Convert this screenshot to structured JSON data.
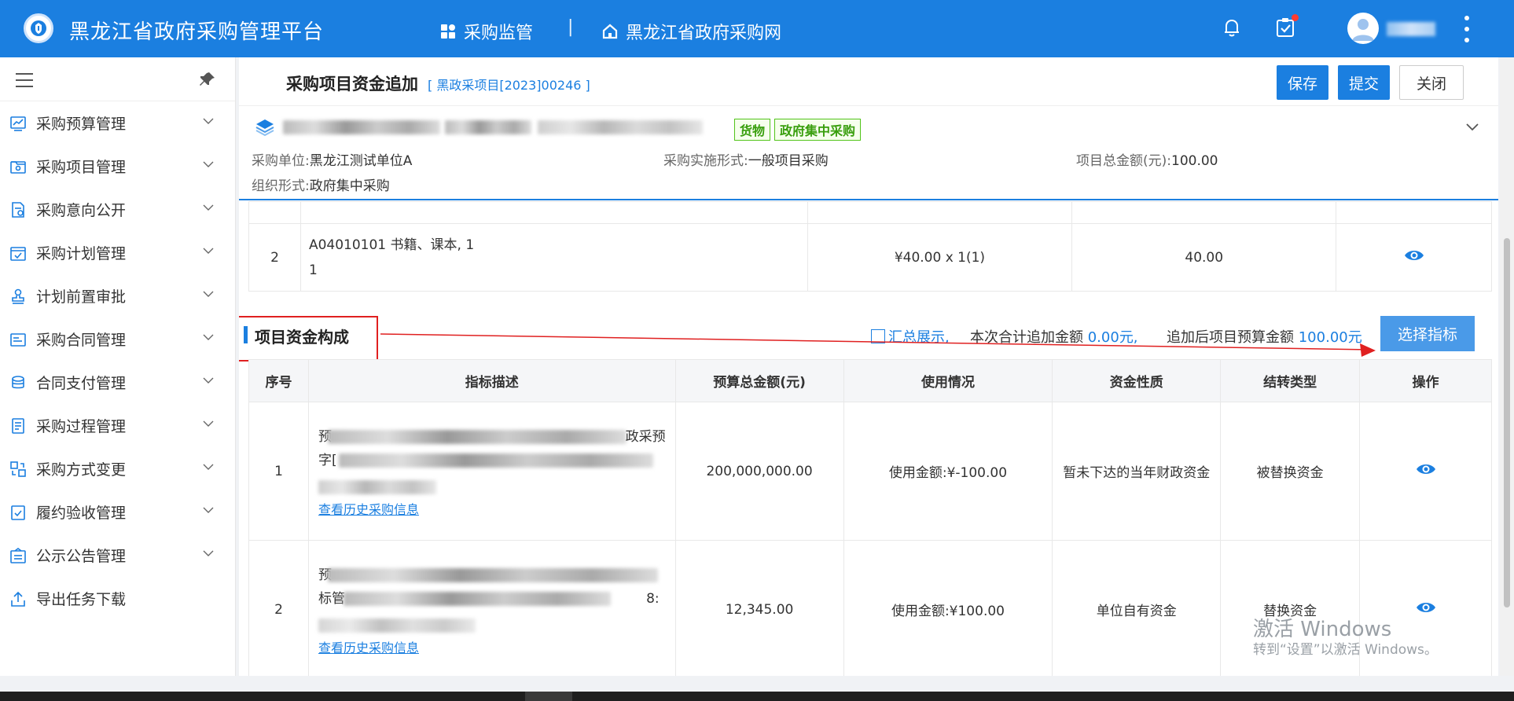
{
  "header": {
    "app_title": "黑龙江省政府采购管理平台",
    "nav": [
      {
        "label": "采购监管",
        "icon": "grid-icon"
      },
      {
        "label": "黑龙江省政府采购网",
        "icon": "home-icon"
      }
    ],
    "separator": "|",
    "icons": [
      "bell-icon",
      "clipboard-check-icon",
      "avatar",
      "more-vertical-icon"
    ]
  },
  "sidebar": {
    "items": [
      {
        "label": "采购预算管理",
        "icon": "chart-icon"
      },
      {
        "label": "采购项目管理",
        "icon": "folder-icon"
      },
      {
        "label": "采购意向公开",
        "icon": "document-icon"
      },
      {
        "label": "采购计划管理",
        "icon": "calendar-icon"
      },
      {
        "label": "计划前置审批",
        "icon": "stamp-icon"
      },
      {
        "label": "采购合同管理",
        "icon": "contract-icon"
      },
      {
        "label": "合同支付管理",
        "icon": "coins-icon"
      },
      {
        "label": "采购过程管理",
        "icon": "process-icon"
      },
      {
        "label": "采购方式变更",
        "icon": "switch-icon"
      },
      {
        "label": "履约验收管理",
        "icon": "check-doc-icon"
      },
      {
        "label": "公示公告管理",
        "icon": "notice-icon"
      },
      {
        "label": "导出任务下载",
        "icon": "upload-icon"
      }
    ]
  },
  "page": {
    "title": "采购项目资金追加",
    "code": "[ 黑政采项目[2023]00246 ]",
    "buttons": {
      "save": "保存",
      "submit": "提交",
      "close": "关闭"
    }
  },
  "project_info": {
    "tags": [
      "货物",
      "政府集中采购"
    ],
    "fields": [
      {
        "label": "采购单位:",
        "value": "黑龙江测试单位A"
      },
      {
        "label": "采购实施形式:",
        "value": "一般项目采购"
      },
      {
        "label": "项目总金额(元):",
        "value": "100.00"
      },
      {
        "label": "组织形式:",
        "value": "政府集中采购"
      }
    ]
  },
  "items_table": {
    "rows": [
      {
        "no": "2",
        "desc_line1": "A04010101 书籍、课本, 1",
        "desc_line2": "1",
        "price": "¥40.00 x 1(1)",
        "amount": "40.00"
      }
    ]
  },
  "fund_section": {
    "title": "项目资金构成",
    "summary_toggle": "汇总展示,",
    "added_label": "本次合计追加金额",
    "added_value": "0.00元,",
    "after_label": "追加后项目预算金额",
    "after_value": "100.00元",
    "select_button": "选择指标",
    "columns": [
      "序号",
      "指标描述",
      "预算总金额(元)",
      "使用情况",
      "资金性质",
      "结转类型",
      "操作"
    ],
    "rows": [
      {
        "no": "1",
        "desc_tail": "政采预",
        "desc_prefix1": "预",
        "desc_prefix2": "字[",
        "link": "查看历史采购信息",
        "budget": "200,000,000.00",
        "usage": "使用金额:¥-100.00",
        "nature": "暂未下达的当年财政资金",
        "carry": "被替换资金"
      },
      {
        "no": "2",
        "desc_tail": "8:",
        "desc_prefix1": "预",
        "desc_prefix2": "标管",
        "link": "查看历史采购信息",
        "budget": "12,345.00",
        "usage": "使用金额:¥100.00",
        "nature": "单位自有资金",
        "carry": "替换资金"
      }
    ]
  },
  "watermark": {
    "line1": "激活 Windows",
    "line2": "转到“设置”以激活 Windows。"
  },
  "colors": {
    "primary": "#1b7fe0",
    "annotation": "#e02020",
    "tag_green": "#52c41a"
  }
}
